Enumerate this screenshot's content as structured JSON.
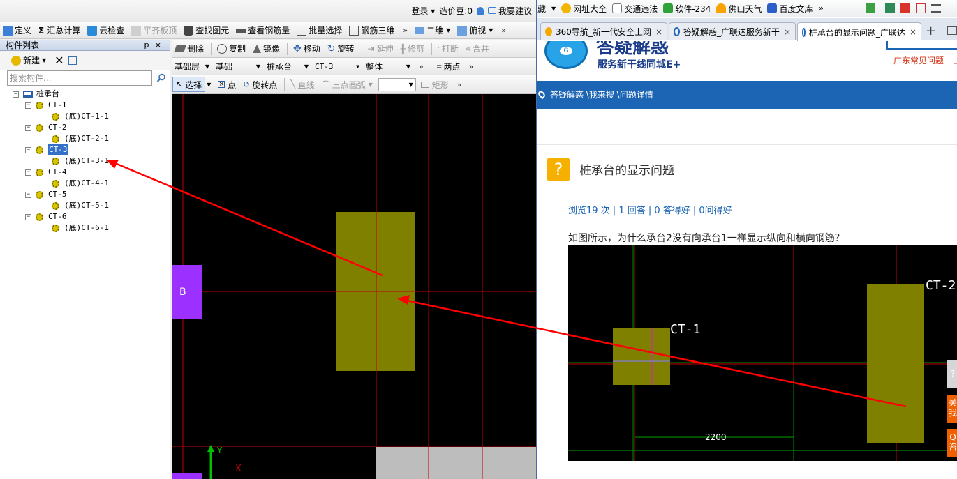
{
  "cad": {
    "topline": {
      "login": "登录",
      "beans": "造价豆:0",
      "suggest": "我要建议"
    },
    "toolbar1": [
      "定义",
      "汇总计算",
      "云检查",
      "平齐板顶",
      "查找图元",
      "查看钢筋量",
      "批量选择",
      "钢筋三维",
      "二维",
      "俯视"
    ],
    "toolbar2": [
      "删除",
      "复制",
      "镜像",
      "移动",
      "旋转",
      "延伸",
      "修剪",
      "打断",
      "合并"
    ],
    "toolbar3": {
      "floor": "基础层",
      "category": "基础",
      "type": "桩承台",
      "item": "CT-3",
      "mode": "整体",
      "two_point": "两点"
    },
    "toolbar4": [
      "选择",
      "点",
      "旋转点",
      "直线",
      "三点画弧",
      "矩形"
    ],
    "panel": {
      "title": "构件列表",
      "new": "新建",
      "search_placeholder": "搜索构件..."
    },
    "tree": {
      "root": "桩承台",
      "items": [
        {
          "name": "CT-1",
          "child": "(底)CT-1-1"
        },
        {
          "name": "CT-2",
          "child": "(底)CT-2-1"
        },
        {
          "name": "CT-3",
          "child": "(底)CT-3-1"
        },
        {
          "name": "CT-4",
          "child": "(底)CT-4-1"
        },
        {
          "name": "CT-5",
          "child": "(底)CT-5-1"
        },
        {
          "name": "CT-6",
          "child": "(底)CT-6-1"
        }
      ],
      "selected": "CT-3"
    },
    "canvas": {
      "axis_label": "B",
      "y_label": "Y",
      "x_label": "X"
    }
  },
  "browser": {
    "bookmarks": [
      "藏",
      "网址大全",
      "交通违法",
      "软件-234",
      "佛山天气",
      "百度文库"
    ],
    "tabs": [
      "360导航_新一代安全上网",
      "答疑解惑_广联达服务新干",
      "桩承台的显示问题_广联达"
    ],
    "page": {
      "brand_title": "答疑解惑",
      "brand_sub": "服务新干线同城E+",
      "region_link": "广东常见问题",
      "region_extra": "上",
      "breadcrumb": "答疑解惑 \\我来搜 \\问题详情",
      "question_title": "桩承台的显示问题",
      "stats": "浏览19 次 | 1 回答 | 0 答得好 | 0问得好",
      "question_text": "如图所示，为什么承台2没有向承台1一样显示纵向和横向钢筋？",
      "shot_label_1": "CT-1",
      "shot_label_2": "CT-2",
      "shot_dim": "2200",
      "side_btns": [
        "关",
        "我",
        "Q",
        "咨"
      ]
    }
  },
  "colors": {
    "cad_bg": "#000000",
    "cap_fill": "#808000",
    "axis_red": "#c00000",
    "axis_green": "#00a000",
    "arrow": "#ff0000",
    "purple": "#9b30ff",
    "site_blue": "#1c65b4"
  }
}
